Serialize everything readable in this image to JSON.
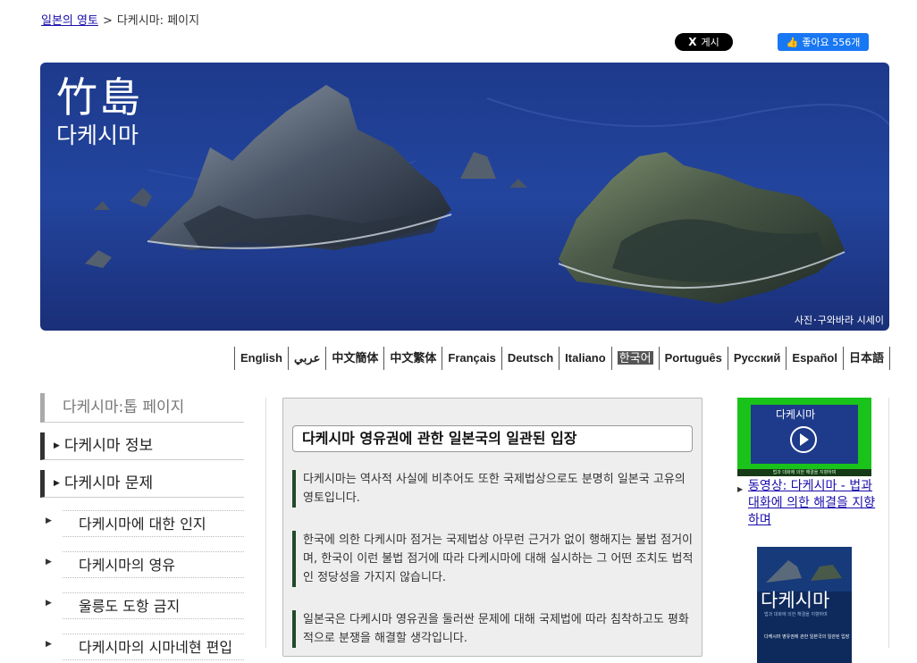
{
  "breadcrumb": {
    "home_link": "일본의 영토",
    "separator": ">",
    "current": "다케시마: 페이지"
  },
  "social": {
    "x_label": "게시",
    "x_glyph": "X",
    "like_label": "좋아요 556개"
  },
  "hero": {
    "title_kanji": "竹島",
    "title_korean": "다케시마",
    "credit": "사진･구와바라 시세이"
  },
  "languages": [
    {
      "label": "English"
    },
    {
      "label": "عربي"
    },
    {
      "label": "中文簡体"
    },
    {
      "label": "中文繁体"
    },
    {
      "label": "Français"
    },
    {
      "label": "Deutsch"
    },
    {
      "label": "Italiano"
    },
    {
      "label": "한국어",
      "active": true
    },
    {
      "label": "Português"
    },
    {
      "label": "Русский"
    },
    {
      "label": "Español"
    },
    {
      "label": "日本語"
    }
  ],
  "sidebar": {
    "top": "다케시마:톱 페이지",
    "main1": "다케시마 정보",
    "main2": "다케시마 문제",
    "sub": [
      "다케시마에 대한 인지",
      "다케시마의 영유",
      "울릉도 도항 금지",
      "다케시마의 시마네현 편입"
    ]
  },
  "main": {
    "title": "다케시마 영유권에 관한 일본국의 일관된 입장",
    "paragraphs": [
      "다케시마는 역사적 사실에 비추어도 또한 국제법상으로도 분명히 일본국 고유의 영토입니다.",
      "한국에 의한 다케시마 점거는 국제법상 아무런 근거가 없이 행해지는 불법 점거이며, 한국이 이런 불법 점거에 따라 다케시마에 대해 실시하는 그 어떤 조치도 법적인 정당성을 가지지 않습니다.",
      "일본국은 다케시마 영유권을 둘러싼 문제에 대해 국제법에 따라 침착하고도 평화적으로 분쟁을 해결할 생각입니다."
    ]
  },
  "right": {
    "video_title": "다케시마",
    "video_subtitle": "법과 대화에 의한 해결을 지향하며",
    "video_link": "동영상: 다케시마 - 법과 대화에 의한 해결을 지향하며",
    "book_title": "다케시마",
    "book_subtitle": "법과 대화에 의한 해결을 지향하며",
    "book_blurb": "다케시마 영유권에 관한 일본국의 일관된 입장"
  },
  "colors": {
    "link": "#1a0dab",
    "like_blue": "#1877f2",
    "accent_bar": "#224a2a",
    "video_green": "#19c319"
  }
}
